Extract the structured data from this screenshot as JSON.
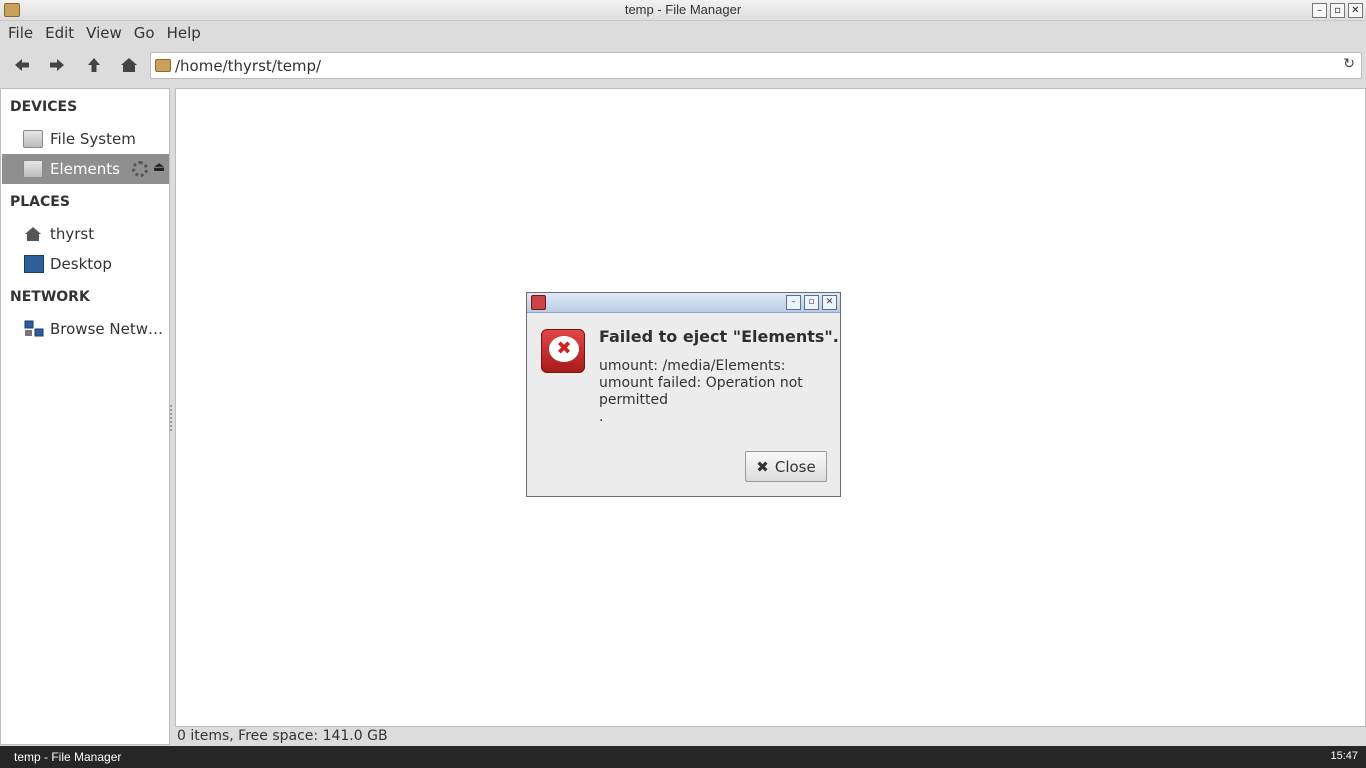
{
  "window": {
    "title": "temp - File Manager"
  },
  "menu": [
    "File",
    "Edit",
    "View",
    "Go",
    "Help"
  ],
  "toolbar": {
    "back_icon": "back-arrow",
    "forward_icon": "forward-arrow",
    "up_icon": "up-arrow",
    "home_icon": "home",
    "path": "/home/thyrst/temp/"
  },
  "sidebar": {
    "devices_header": "DEVICES",
    "devices": [
      {
        "label": "File System",
        "icon": "drive-icon"
      },
      {
        "label": "Elements",
        "icon": "drive-icon",
        "selected": true
      }
    ],
    "places_header": "PLACES",
    "places": [
      {
        "label": "thyrst",
        "icon": "home-icon"
      },
      {
        "label": "Desktop",
        "icon": "desktop-icon"
      }
    ],
    "network_header": "NETWORK",
    "network": [
      {
        "label": "Browse Netw…",
        "icon": "network-icon"
      }
    ]
  },
  "status": {
    "text": "0 items, Free space: 141.0 GB"
  },
  "taskbar": {
    "task": "temp - File Manager",
    "clock": "15:47"
  },
  "dialog": {
    "heading": "Failed to eject \"Elements\".",
    "message_lines": [
      "umount: /media/Elements:",
      "umount failed: Operation not",
      "permitted",
      "."
    ],
    "close_label": "Close",
    "accent": "#c22222"
  }
}
